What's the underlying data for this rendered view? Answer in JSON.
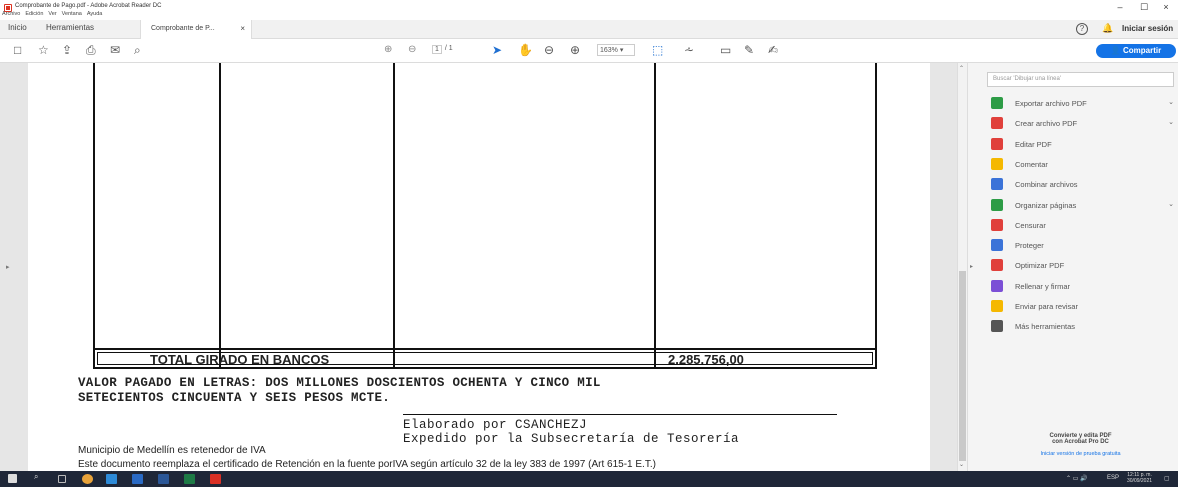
{
  "window": {
    "title": "Comprobante de Pago.pdf - Adobe Acrobat Reader DC",
    "menu": [
      "Archivo",
      "Edición",
      "Ver",
      "Ventana",
      "Ayuda"
    ],
    "minimize": "–",
    "maximize": "☐",
    "close": "×"
  },
  "tabs": {
    "home": "Inicio",
    "tools": "Herramientas",
    "document": "Comprobante de P...",
    "close": "×",
    "help": "?",
    "signin": "Iniciar sesión"
  },
  "toolbar": {
    "page_current": "1",
    "page_total": "/ 1",
    "zoom": "163%",
    "share": "Compartir"
  },
  "document": {
    "total_label": "TOTAL GIRADO EN BANCOS",
    "total_value": "2.285.756,00",
    "letras_line1": "VALOR PAGADO EN LETRAS: DOS MILLONES DOSCIENTOS OCHENTA Y CINCO MIL",
    "letras_line2": "SETECIENTOS CINCUENTA Y SEIS PESOS MCTE.",
    "elaborado": "Elaborado por CSANCHEZJ",
    "expedido": "Expedido por la Subsecretaría de Tesorería",
    "municipio": "Municipio de Medellín es retenedor de IVA",
    "reemplaza": "Este documento reemplaza el certificado de Retención en la fuente porIVA según artículo 32 de la ley 383 de 1997 (Art 615-1 E.T.)"
  },
  "tools_panel": {
    "search_placeholder": "Buscar 'Dibujar una línea'",
    "items": [
      {
        "label": "Exportar archivo PDF",
        "icon": "export-pdf-icon",
        "color": "#2d9c46",
        "chevron": "⌄"
      },
      {
        "label": "Crear archivo PDF",
        "icon": "create-pdf-icon",
        "color": "#e0403b",
        "chevron": "⌄"
      },
      {
        "label": "Editar PDF",
        "icon": "edit-pdf-icon",
        "color": "#e0403b",
        "chevron": ""
      },
      {
        "label": "Comentar",
        "icon": "comment-icon",
        "color": "#f5b800",
        "chevron": ""
      },
      {
        "label": "Combinar archivos",
        "icon": "combine-files-icon",
        "color": "#3b73d8",
        "chevron": ""
      },
      {
        "label": "Organizar páginas",
        "icon": "organize-pages-icon",
        "color": "#2d9c46",
        "chevron": "⌄"
      },
      {
        "label": "Censurar",
        "icon": "redact-icon",
        "color": "#e0403b",
        "chevron": ""
      },
      {
        "label": "Proteger",
        "icon": "protect-icon",
        "color": "#3b73d8",
        "chevron": ""
      },
      {
        "label": "Optimizar PDF",
        "icon": "optimize-pdf-icon",
        "color": "#e0403b",
        "chevron": ""
      },
      {
        "label": "Rellenar y firmar",
        "icon": "fill-sign-icon",
        "color": "#7b4fd6",
        "chevron": ""
      },
      {
        "label": "Enviar para revisar",
        "icon": "send-review-icon",
        "color": "#f5b800",
        "chevron": ""
      },
      {
        "label": "Más herramientas",
        "icon": "more-tools-icon",
        "color": "#555555",
        "chevron": ""
      }
    ],
    "convert_title1": "Convierte y edita PDF",
    "convert_title2": "con Acrobat Pro DC",
    "convert_link": "Iniciar versión de prueba gratuita"
  },
  "taskbar": {
    "time": "12:11 p. m.",
    "date": "30/09/2021",
    "lang": "ESP"
  }
}
